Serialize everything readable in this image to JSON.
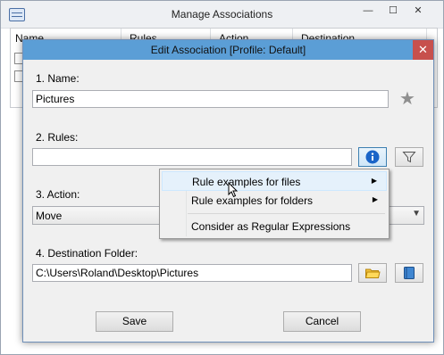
{
  "parent": {
    "title": "Manage Associations",
    "controls": [
      "—",
      "☐",
      "✕"
    ],
    "columns": [
      "Name",
      "Rules",
      "Action",
      "Destination"
    ]
  },
  "dialog": {
    "title": "Edit Association [Profile: Default]",
    "close": "✕",
    "name_label": "1. Name:",
    "name_value": "Pictures",
    "rules_label": "2. Rules:",
    "rules_value": "",
    "action_label": "3. Action:",
    "action_value": "Move",
    "dest_label": "4. Destination Folder:",
    "dest_value": "C:\\Users\\Roland\\Desktop\\Pictures",
    "save": "Save",
    "cancel": "Cancel"
  },
  "menu": {
    "items": [
      "Rule examples for files",
      "Rule examples for folders",
      "Consider as Regular Expressions"
    ]
  },
  "icons": {
    "favorite": "star-icon",
    "info": "info-icon",
    "filter": "filter-icon",
    "folder": "folder-icon",
    "book": "book-icon"
  },
  "colors": {
    "titlebar": "#5b9ed6",
    "close": "#c7504d",
    "info": "#1a64c8"
  }
}
